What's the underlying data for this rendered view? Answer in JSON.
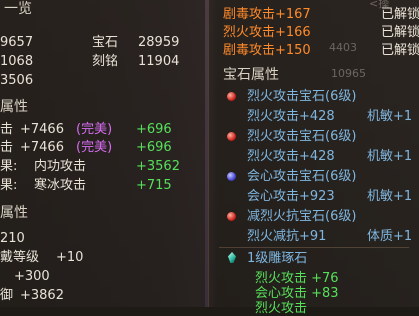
{
  "left": {
    "overview_title": "一览",
    "stat_rows": [
      {
        "val1": "9657",
        "label2": "宝石",
        "val2": "28959"
      },
      {
        "val1": "1068",
        "label2": "刻铭",
        "val2": "11904"
      },
      {
        "val1": "3506"
      }
    ],
    "attr_title": "属性",
    "attack_rows": [
      {
        "label": "击",
        "value": "+7466",
        "tag": "(完美)",
        "bonus": "+696"
      },
      {
        "label": "击",
        "value": "+7466",
        "tag": "(完美)",
        "bonus": "+696"
      }
    ],
    "effect_rows": [
      {
        "label": "果:",
        "name": "内功攻击",
        "value": "+3562"
      },
      {
        "label": "果:",
        "name": "寒冰攻击",
        "value": "+715"
      }
    ],
    "attr2_title": "属性",
    "bottom_rows": [
      {
        "text": "210"
      },
      {
        "text": "戴等级",
        "value": "+10"
      },
      {
        "text": "+300"
      },
      {
        "text": "御",
        "value": "+3862"
      }
    ]
  },
  "right": {
    "top_ghost": "<操",
    "top_ghost_num": "4403",
    "top_rows": [
      {
        "label": "剧毒攻击+167",
        "status": "已解锁"
      },
      {
        "label": "烈火攻击+166",
        "status": "已解锁"
      },
      {
        "label": "剧毒攻击+150",
        "status": "已解锁"
      }
    ],
    "gem_title": "宝石属性",
    "gem_ghost_num": "10965",
    "gems": [
      {
        "name": "烈火攻击宝石(6级)",
        "stat": "烈火攻击+428",
        "extra": "机敏+1",
        "icon": "red"
      },
      {
        "name": "烈火攻击宝石(6级)",
        "stat": "烈火攻击+428",
        "extra": "机敏+1",
        "icon": "red"
      },
      {
        "name": "会心攻击宝石(6级)",
        "stat": "会心攻击+923",
        "extra": "机敏+1",
        "icon": "blue"
      },
      {
        "name": "减烈火抗宝石(6级)",
        "stat": "烈火减抗+91",
        "extra": "体质+1",
        "icon": "red"
      }
    ],
    "stone": {
      "name": "1级雕琢石",
      "lines": [
        "烈火攻击 +76",
        "会心攻击 +83",
        "烈火攻击"
      ]
    }
  },
  "colors": {
    "green": "#56e05a",
    "purple": "#d56cf0",
    "orange": "#ff8a2a",
    "gem_blue": "#7fb6e0",
    "text": "#e8e2d6"
  }
}
